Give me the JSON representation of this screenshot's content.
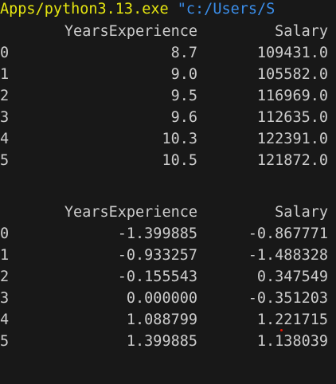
{
  "terminal": {
    "command_path": "Apps/python3.13.exe",
    "command_arg": "\"c:/Users/S",
    "table_raw": {
      "columns": [
        "YearsExperience",
        "Salary"
      ],
      "rows": [
        {
          "index": "0",
          "years": "8.7",
          "salary": "109431.0"
        },
        {
          "index": "1",
          "years": "9.0",
          "salary": "105582.0"
        },
        {
          "index": "2",
          "years": "9.5",
          "salary": "116969.0"
        },
        {
          "index": "3",
          "years": "9.6",
          "salary": "112635.0"
        },
        {
          "index": "4",
          "years": "10.3",
          "salary": "122391.0"
        },
        {
          "index": "5",
          "years": "10.5",
          "salary": "121872.0"
        }
      ]
    },
    "table_scaled": {
      "columns": [
        "YearsExperience",
        "Salary"
      ],
      "rows": [
        {
          "index": "0",
          "years": "-1.399885",
          "salary": "-0.867771"
        },
        {
          "index": "1",
          "years": "-0.933257",
          "salary": "-1.488328"
        },
        {
          "index": "2",
          "years": "-0.155543",
          "salary": "0.347549"
        },
        {
          "index": "3",
          "years": "0.000000",
          "salary": "-0.351203"
        },
        {
          "index": "4",
          "years": "1.088799",
          "salary": "1.221715"
        },
        {
          "index": "5",
          "years": "1.399885",
          "salary": "1.138039"
        }
      ]
    },
    "colors": {
      "background": "#181818",
      "text": "#cccccc",
      "command_path": "#e5e510",
      "command_arg": "#3b8eea",
      "cursor_dot": "#e51400"
    }
  }
}
